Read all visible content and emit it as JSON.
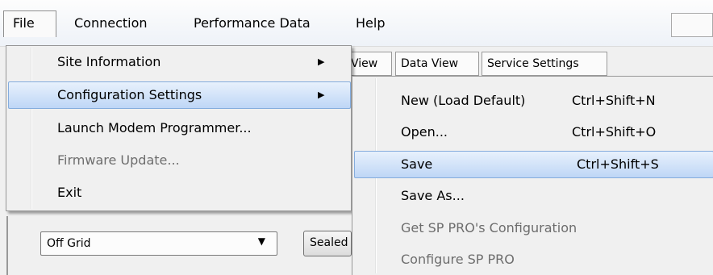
{
  "menubar": {
    "items": [
      "File",
      "Connection",
      "Performance Data",
      "Help"
    ]
  },
  "tabs": [
    "View",
    "Data View",
    "Service Settings"
  ],
  "mode_select": {
    "value": "Off Grid"
  },
  "battery_button": {
    "label": "Sealed"
  },
  "file_menu": {
    "items": [
      {
        "label": "Site Information",
        "submenu": true,
        "enabled": true
      },
      {
        "label": "Configuration Settings",
        "submenu": true,
        "enabled": true,
        "highlighted": true
      },
      {
        "label": "Launch Modem Programmer...",
        "enabled": true
      },
      {
        "label": "Firmware Update...",
        "enabled": false
      },
      {
        "label": "Exit",
        "enabled": true
      }
    ],
    "submenu_arrow": "▶"
  },
  "config_submenu": {
    "items": [
      {
        "label": "New (Load Default)",
        "shortcut": "Ctrl+Shift+N",
        "enabled": true
      },
      {
        "label": "Open...",
        "shortcut": "Ctrl+Shift+O",
        "enabled": true
      },
      {
        "label": "Save",
        "shortcut": "Ctrl+Shift+S",
        "enabled": true,
        "highlighted": true
      },
      {
        "label": "Save As...",
        "shortcut": "",
        "enabled": true
      },
      {
        "label": "Get SP PRO's Configuration",
        "shortcut": "",
        "enabled": false
      },
      {
        "label": "Configure SP PRO",
        "shortcut": "",
        "enabled": false
      }
    ]
  },
  "combo_arrow": "▼"
}
